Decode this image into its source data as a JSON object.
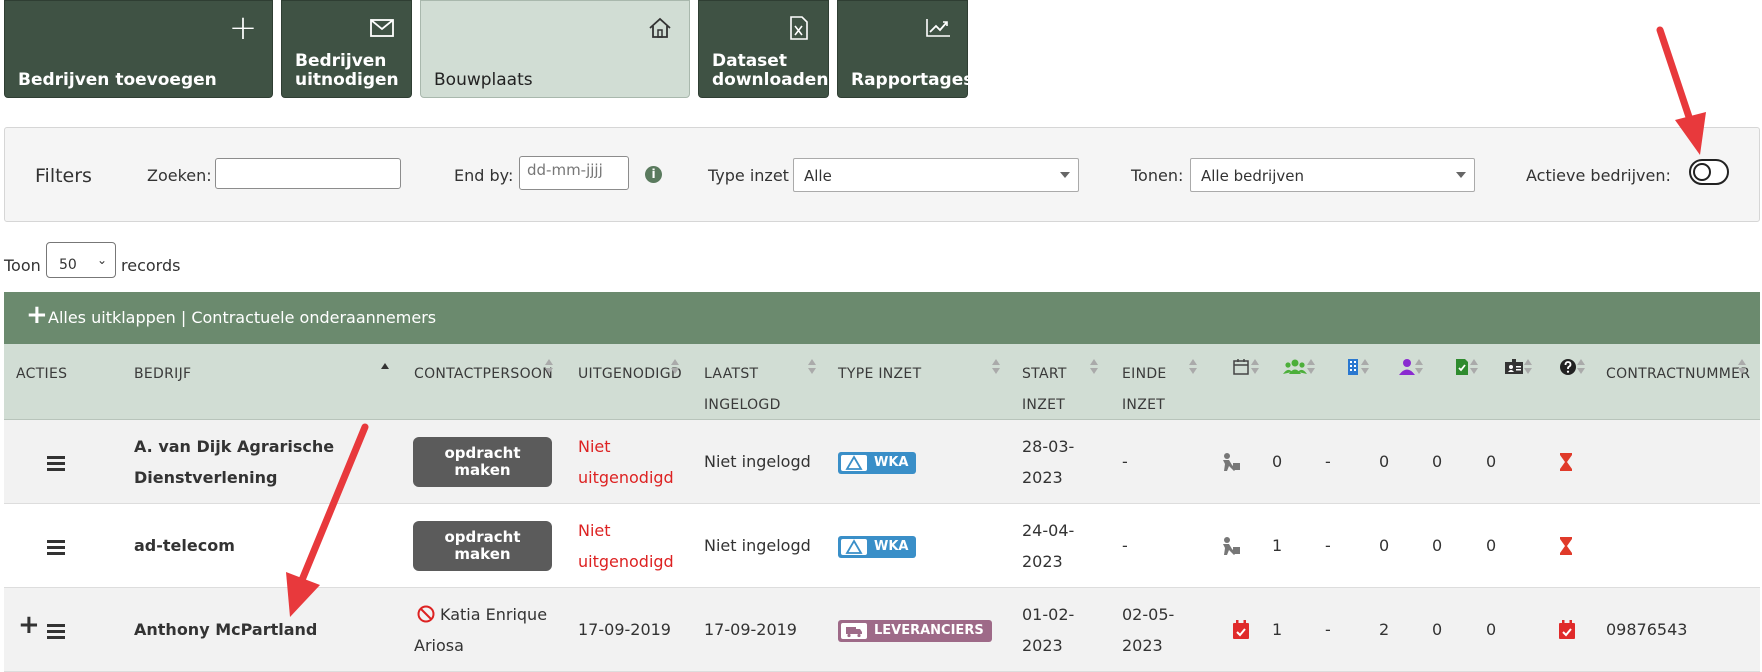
{
  "tiles": [
    {
      "label": "Bedrijven toevoegen",
      "icon": "plus-icon"
    },
    {
      "label": "Bedrijven\nuitnodigen",
      "icon": "envelope-icon"
    },
    {
      "label": "Bouwplaats",
      "icon": "home-icon"
    },
    {
      "label": "Dataset\ndownloaden",
      "icon": "excel-file-icon"
    },
    {
      "label": "Rapportages",
      "icon": "chart-icon"
    }
  ],
  "filters": {
    "title": "Filters",
    "search_label": "Zoeken:",
    "search_value": "",
    "endby_label": "End by:",
    "endby_placeholder": "dd-mm-jjjj",
    "type_label": "Type inzet",
    "type_value": "Alle",
    "show_label": "Tonen:",
    "show_value": "Alle bedrijven",
    "active_label": "Actieve bedrijven:",
    "active_on": false
  },
  "records": {
    "prefix": "Toon",
    "value": "50",
    "suffix": "records"
  },
  "group_bar": {
    "text": "Alles uitklappen | Contractuele onderaannemers"
  },
  "columns": {
    "acties": "ACTIES",
    "bedrijf": "BEDRIJF",
    "contact": "CONTACTPERSOON",
    "uitgenodigd": "UITGENODIGD",
    "laatst1": "LAATST",
    "laatst2": "INGELOGD",
    "type": "TYPE INZET",
    "start1": "START",
    "start2": "INZET",
    "einde1": "EINDE",
    "einde2": "INZET",
    "contractnummer": "CONTRACTNUMMER"
  },
  "rows": [
    {
      "bedrijf1": "A. van Dijk Agrarische",
      "bedrijf2": "Dienstverlening",
      "contact_button": "opdracht\nmaken",
      "uitgenodigd1": "Niet",
      "uitgenodigd2": "uitgenodigd",
      "laatst": "Niet ingelogd",
      "type": "WKA",
      "start1": "28-03-",
      "start2": "2023",
      "einde": "-",
      "c1": "0",
      "c2": "-",
      "c3": "0",
      "c4": "0",
      "c5": "0",
      "contractnummer": ""
    },
    {
      "bedrijf1": "ad-telecom",
      "contact_button": "opdracht\nmaken",
      "uitgenodigd1": "Niet",
      "uitgenodigd2": "uitgenodigd",
      "laatst": "Niet ingelogd",
      "type": "WKA",
      "start1": "24-04-",
      "start2": "2023",
      "einde": "-",
      "c1": "1",
      "c2": "-",
      "c3": "0",
      "c4": "0",
      "c5": "0",
      "contractnummer": ""
    },
    {
      "bedrijf1": "Anthony McPartland",
      "contact1": "Katia Enrique",
      "contact2": "Ariosa",
      "uitgenodigd": "17-09-2019",
      "laatst": "17-09-2019",
      "type": "LEVERANCIERS",
      "start1": "01-02-",
      "start2": "2023",
      "einde1": "02-05-",
      "einde2": "2023",
      "c1": "1",
      "c2": "-",
      "c3": "2",
      "c4": "0",
      "c5": "0",
      "contractnummer": "09876543"
    }
  ],
  "colors": {
    "tile_dark": "#3f5244",
    "tile_active": "#d1ddd4",
    "group_bar": "#6b8a6e",
    "header": "#d1ddd4",
    "wka_badge": "#3a8fc8",
    "lev_badge": "#9e6a88",
    "danger": "#dd2222",
    "annotation_arrow": "#e8393c"
  }
}
